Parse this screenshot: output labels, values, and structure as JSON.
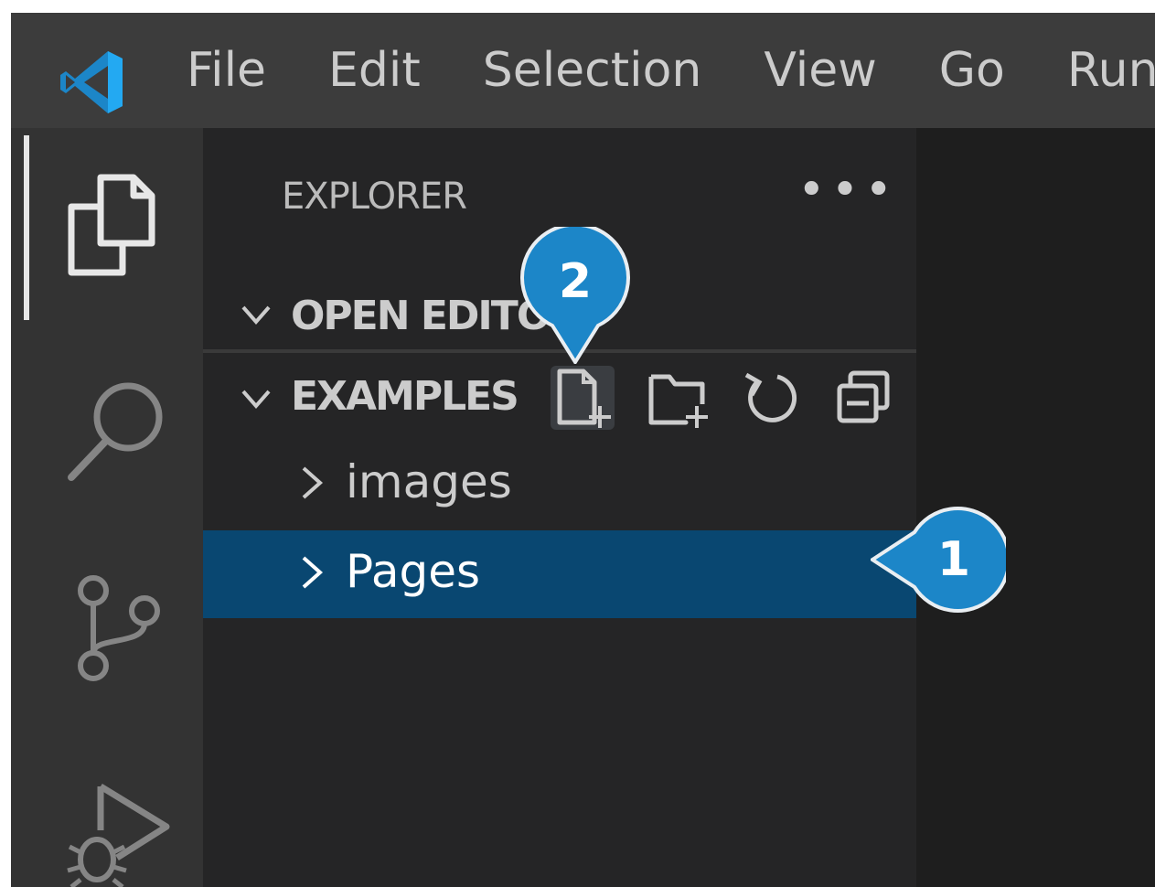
{
  "window": {
    "menu": [
      "File",
      "Edit",
      "Selection",
      "View",
      "Go",
      "Run"
    ]
  },
  "icons": {
    "logo": "vscode-logo-icon",
    "activity": [
      "explorer-files-icon",
      "search-icon",
      "source-control-icon",
      "run-debug-icon"
    ],
    "section_toolbar": [
      "new-file-icon",
      "new-folder-icon",
      "refresh-icon",
      "collapse-all-icon"
    ]
  },
  "explorer": {
    "title": "EXPLORER",
    "more_actions": "•••",
    "open_editors": {
      "label": "OPEN EDITO",
      "expanded": true
    },
    "workspace": {
      "label": "EXAMPLES",
      "expanded": true
    },
    "tree": [
      {
        "label": "images",
        "expanded": false,
        "selected": false
      },
      {
        "label": "Pages",
        "expanded": false,
        "selected": true
      }
    ]
  },
  "callouts": [
    {
      "number": "1",
      "target": "Pages"
    },
    {
      "number": "2",
      "target": "New File"
    }
  ],
  "colors": {
    "titlebar": "#3c3c3c",
    "activitybar": "#333333",
    "sidebar": "#252526",
    "editor": "#1e1e1e",
    "selection": "#094771",
    "callout": "#1c86c8",
    "logo": "#23a9f2"
  }
}
